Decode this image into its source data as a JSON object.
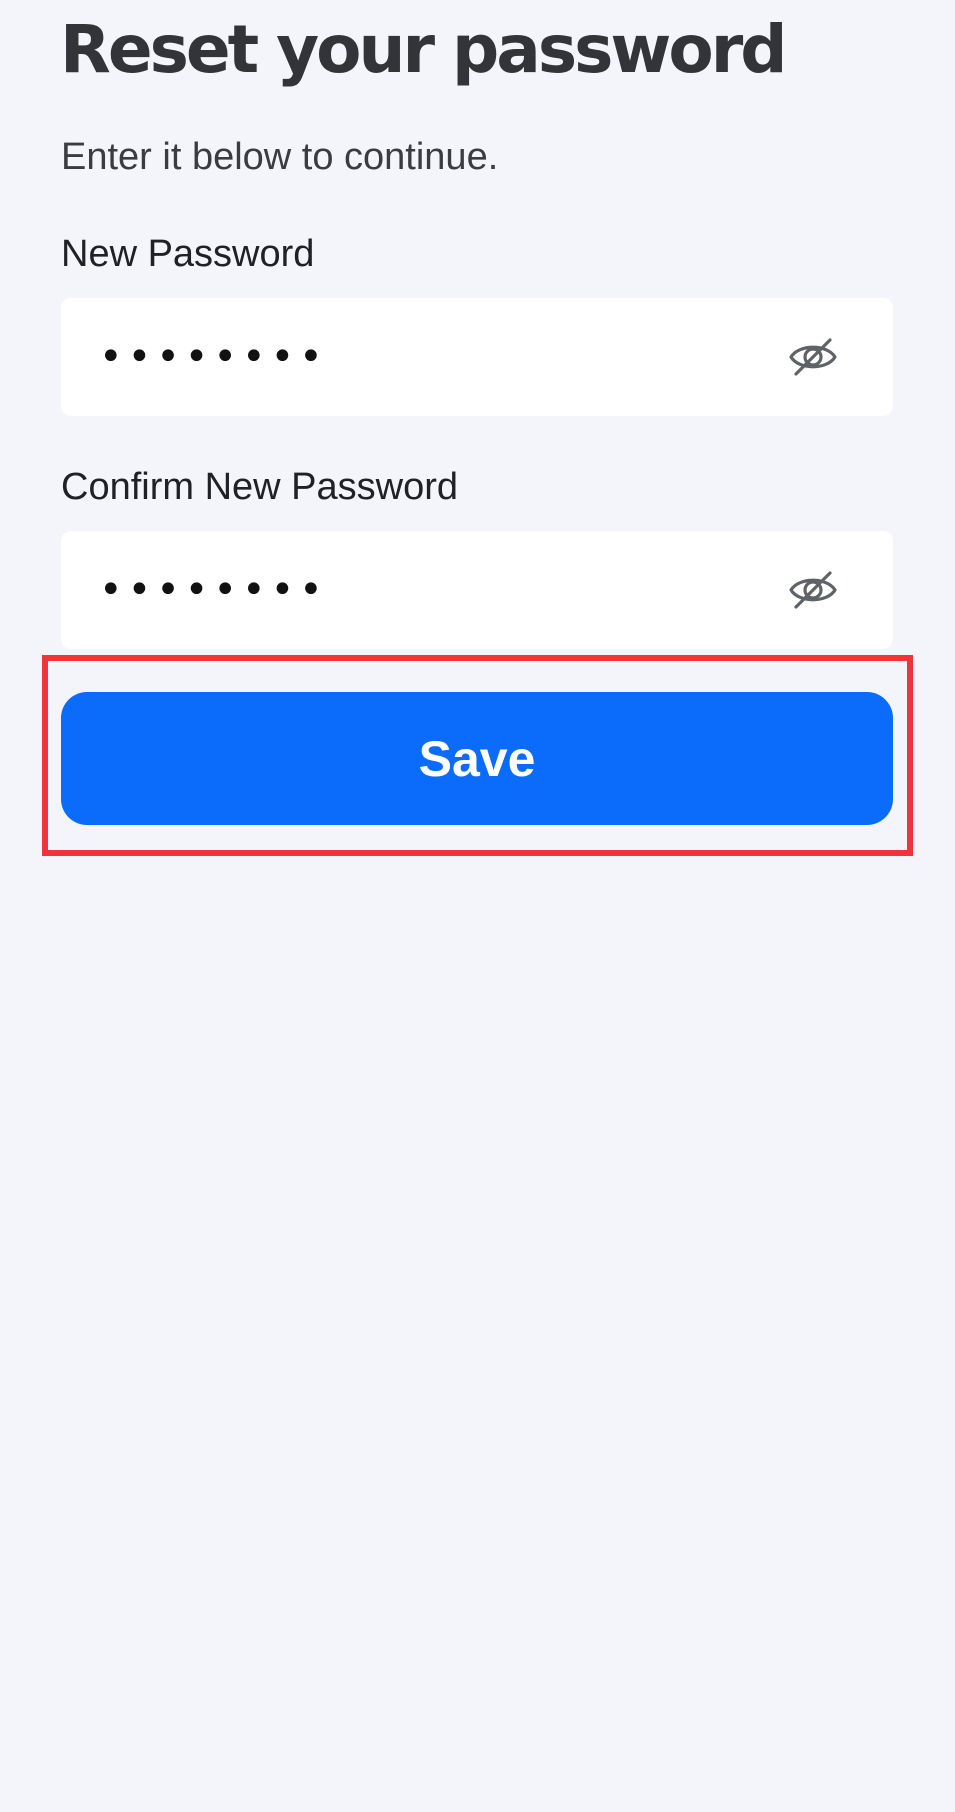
{
  "header": {
    "title": "Reset your password",
    "subtitle": "Enter it below to continue."
  },
  "form": {
    "new_password": {
      "label": "New Password",
      "value": "••••••••",
      "toggle_icon": "eye-off-icon"
    },
    "confirm_password": {
      "label": "Confirm New Password",
      "value": "••••••••",
      "toggle_icon": "eye-off-icon"
    },
    "save_label": "Save"
  },
  "colors": {
    "background": "#f4f5fa",
    "accent": "#0b6cfb",
    "highlight": "#f2333a"
  }
}
